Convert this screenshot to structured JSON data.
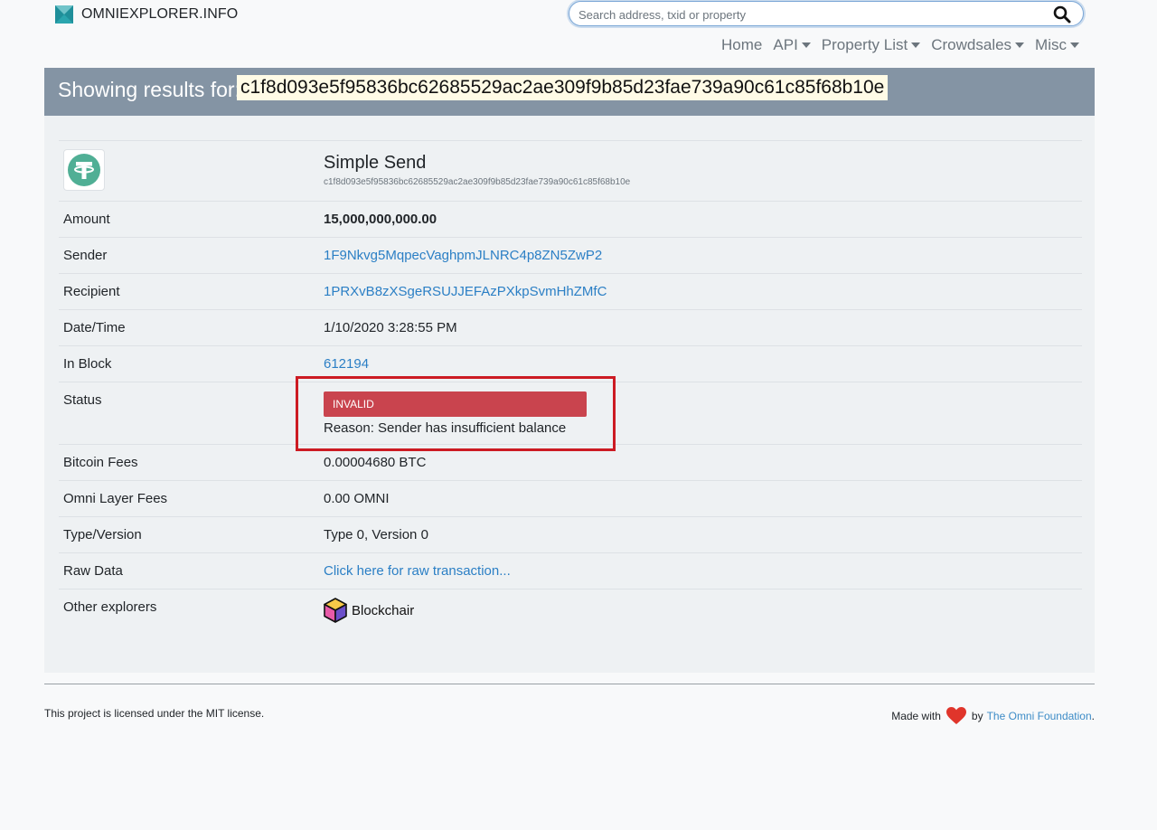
{
  "brand": {
    "name": "OMNIEXPLORER.INFO"
  },
  "search": {
    "placeholder": "Search address, txid or property"
  },
  "nav": [
    {
      "label": "Home",
      "dropdown": false
    },
    {
      "label": "API",
      "dropdown": true
    },
    {
      "label": "Property List",
      "dropdown": true
    },
    {
      "label": "Crowdsales",
      "dropdown": true
    },
    {
      "label": "Misc",
      "dropdown": true
    }
  ],
  "banner": {
    "label": "Showing results for:",
    "query": "c1f8d093e5f95836bc62685529ac2ae309f9b85d23fae739a90c61c85f68b10e"
  },
  "tx": {
    "type": "Simple Send",
    "txid": "c1f8d093e5f95836bc62685529ac2ae309f9b85d23fae739a90c61c85f68b10e",
    "token_icon": "tether-icon",
    "rows": {
      "amount": {
        "label": "Amount",
        "value": "15,000,000,000.00"
      },
      "sender": {
        "label": "Sender",
        "value": "1F9Nkvg5MqpecVaghpmJLNRC4p8ZN5ZwP2"
      },
      "recipient": {
        "label": "Recipient",
        "value": "1PRXvB8zXSgeRSUJJEFAzPXkpSvmHhZMfC"
      },
      "datetime": {
        "label": "Date/Time",
        "value": "1/10/2020 3:28:55 PM"
      },
      "block": {
        "label": "In Block",
        "value": "612194"
      },
      "status": {
        "label": "Status",
        "badge": "INVALID",
        "reason": "Reason: Sender has insufficient balance"
      },
      "btc_fees": {
        "label": "Bitcoin Fees",
        "value": "0.00004680 BTC"
      },
      "omni_fees": {
        "label": "Omni Layer Fees",
        "value": "0.00 OMNI"
      },
      "type_version": {
        "label": "Type/Version",
        "value": "Type 0, Version 0"
      },
      "raw": {
        "label": "Raw Data",
        "value": "Click here for raw transaction..."
      },
      "explorers": {
        "label": "Other explorers",
        "value": "Blockchair"
      }
    }
  },
  "footer": {
    "license": "This project is licensed under the MIT license.",
    "made_with": "Made with",
    "by": "by",
    "org": "The Omni Foundation",
    "period": "."
  },
  "colors": {
    "banner_bg": "#8494a4",
    "link": "#2b7fc5",
    "invalid": "#c9444e",
    "highlight": "#cc1b23",
    "tether": "#50af95",
    "heart": "#e0352b"
  }
}
